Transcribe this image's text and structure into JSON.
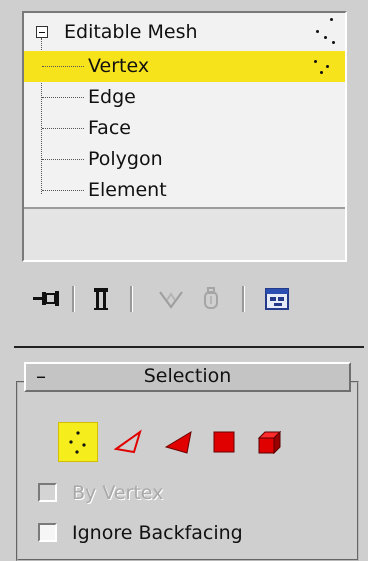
{
  "modifier_stack": {
    "root": {
      "label": "Editable Mesh",
      "expander_icon": "minus-box-icon"
    },
    "items": [
      {
        "label": "Vertex",
        "selected": true
      },
      {
        "label": "Edge"
      },
      {
        "label": "Face"
      },
      {
        "label": "Polygon"
      },
      {
        "label": "Element"
      }
    ]
  },
  "toolbar": {
    "buttons": [
      {
        "icon": "pin-stack-icon",
        "enabled": true
      },
      {
        "icon": "show-end-result-icon",
        "enabled": true
      },
      {
        "icon": "make-unique-icon",
        "enabled": false
      },
      {
        "icon": "remove-modifier-icon",
        "enabled": false
      },
      {
        "icon": "configure-modifier-sets-icon",
        "enabled": true
      }
    ]
  },
  "selection_rollout": {
    "collapse_symbol": "–",
    "title": "Selection",
    "levels": [
      {
        "icon": "vertex-level-icon",
        "active": true
      },
      {
        "icon": "edge-level-icon"
      },
      {
        "icon": "face-level-icon"
      },
      {
        "icon": "polygon-level-icon"
      },
      {
        "icon": "element-level-icon"
      }
    ],
    "checkboxes": [
      {
        "label": "By Vertex",
        "checked": false,
        "enabled": false
      },
      {
        "label": "Ignore Backfacing",
        "checked": false,
        "enabled": true
      }
    ]
  },
  "colors": {
    "selection_highlight": "#f7e31b",
    "panel_background": "#cfcfcf",
    "sub_object_icon_red": "#e00000"
  }
}
